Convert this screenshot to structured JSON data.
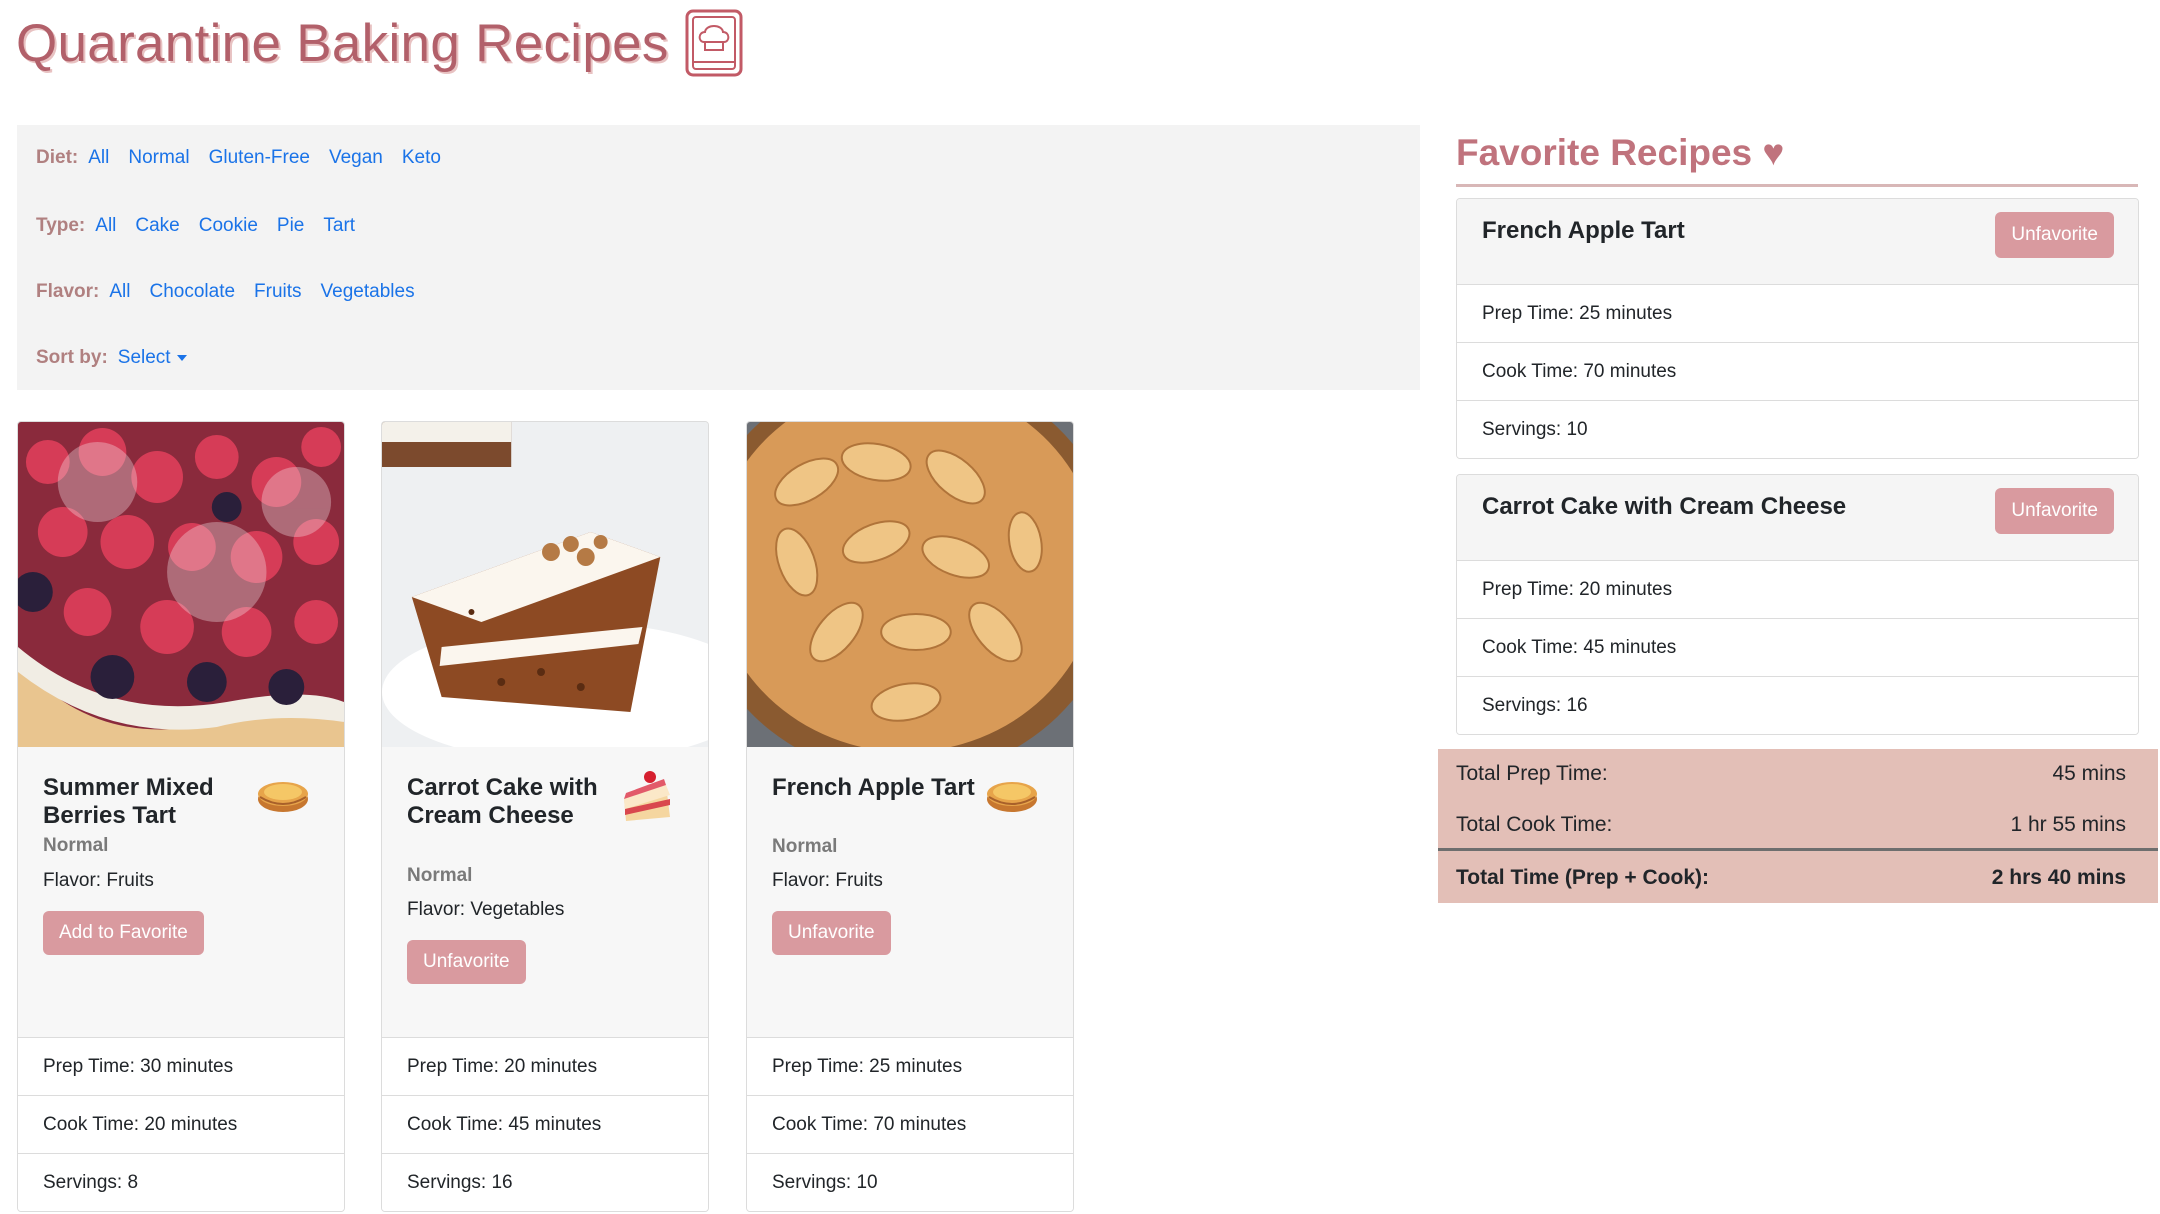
{
  "header": {
    "title": "Quarantine Baking Recipes",
    "icon": "chef-hat-book-icon"
  },
  "filters": {
    "diet": {
      "label": "Diet:",
      "options": [
        "All",
        "Normal",
        "Gluten-Free",
        "Vegan",
        "Keto"
      ]
    },
    "type": {
      "label": "Type:",
      "options": [
        "All",
        "Cake",
        "Cookie",
        "Pie",
        "Tart"
      ]
    },
    "flavor": {
      "label": "Flavor:",
      "options": [
        "All",
        "Chocolate",
        "Fruits",
        "Vegetables"
      ]
    },
    "sort": {
      "label": "Sort by:",
      "value": "Select"
    }
  },
  "recipes": [
    {
      "title": "Summer Mixed Berries Tart",
      "emoji": "🥧",
      "diet": "Normal",
      "flavor": "Flavor: Fruits",
      "button": "Add to Favorite",
      "prep": "Prep Time: 30 minutes",
      "cook": "Cook Time: 20 minutes",
      "servings": "Servings: 8",
      "image": "berries-tart-photo"
    },
    {
      "title": "Carrot Cake with Cream Cheese",
      "emoji": "🍰",
      "diet": "Normal",
      "flavor": "Flavor: Vegetables",
      "button": "Unfavorite",
      "prep": "Prep Time: 20 minutes",
      "cook": "Cook Time: 45 minutes",
      "servings": "Servings: 16",
      "image": "carrot-cake-photo"
    },
    {
      "title": "French Apple Tart",
      "emoji": "🥧",
      "diet": "Normal",
      "flavor": "Flavor: Fruits",
      "button": "Unfavorite",
      "prep": "Prep Time: 25 minutes",
      "cook": "Cook Time: 70 minutes",
      "servings": "Servings: 10",
      "image": "apple-tart-photo"
    }
  ],
  "favorites": {
    "heading": "Favorite Recipes ♥",
    "items": [
      {
        "title": "French Apple Tart",
        "button": "Unfavorite",
        "prep": "Prep Time: 25 minutes",
        "cook": "Cook Time: 70 minutes",
        "servings": "Servings: 10"
      },
      {
        "title": "Carrot Cake with Cream Cheese",
        "button": "Unfavorite",
        "prep": "Prep Time: 20 minutes",
        "cook": "Cook Time: 45 minutes",
        "servings": "Servings: 16"
      }
    ]
  },
  "totals": {
    "prep_label": "Total Prep Time:",
    "prep_value": "45 mins",
    "cook_label": "Total Cook Time:",
    "cook_value": "1 hr 55 mins",
    "total_label": "Total Time (Prep + Cook):",
    "total_value": "2 hrs 40 mins"
  },
  "colors": {
    "accent": "#b2606a",
    "button": "#d99a9f",
    "link": "#1a73e8",
    "totals_bg": "#e3bfb7"
  }
}
